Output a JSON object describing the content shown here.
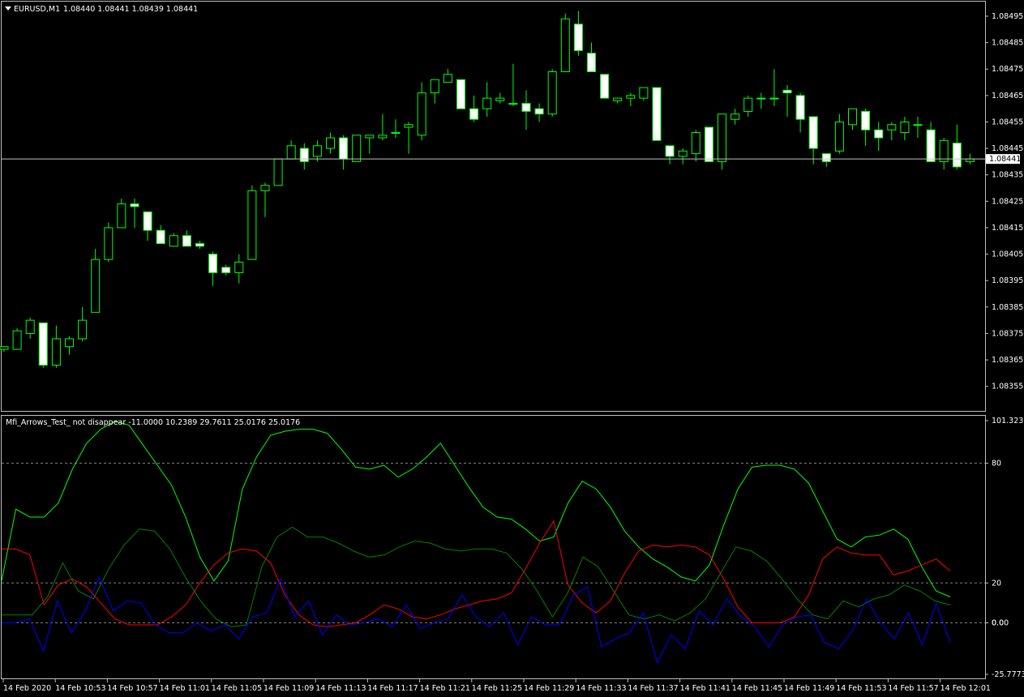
{
  "chart_data": [
    {
      "type": "candlestick",
      "title": "EURUSD,M1",
      "ohlc_header": "1.08440 1.08441 1.08439 1.08441",
      "current_price_label": "1.08441",
      "current_price": 1.08441,
      "ylim": [
        1.0835,
        1.08495
      ],
      "y_ticks": [
        "1.08495",
        "1.08485",
        "1.08475",
        "1.08465",
        "1.08455",
        "1.08445",
        "1.08435",
        "1.08425",
        "1.08415",
        "1.08405",
        "1.08395",
        "1.08385",
        "1.08375",
        "1.08365",
        "1.08355"
      ],
      "colors": {
        "up_outline": "#00ff00",
        "down_body": "#ffffff",
        "wick": "#00ff00",
        "price_line": "#c0c0c0"
      },
      "candles": [
        {
          "o": 1.08369,
          "h": 1.0837,
          "l": 1.08368,
          "c": 1.0837
        },
        {
          "o": 1.08369,
          "h": 1.08377,
          "l": 1.08369,
          "c": 1.08376
        },
        {
          "o": 1.08375,
          "h": 1.08381,
          "l": 1.08373,
          "c": 1.0838
        },
        {
          "o": 1.08379,
          "h": 1.08379,
          "l": 1.08362,
          "c": 1.08363
        },
        {
          "o": 1.08363,
          "h": 1.08378,
          "l": 1.08362,
          "c": 1.08373
        },
        {
          "o": 1.0837,
          "h": 1.08374,
          "l": 1.08367,
          "c": 1.08373
        },
        {
          "o": 1.08373,
          "h": 1.08385,
          "l": 1.08372,
          "c": 1.0838
        },
        {
          "o": 1.08383,
          "h": 1.08407,
          "l": 1.08383,
          "c": 1.08403
        },
        {
          "o": 1.08403,
          "h": 1.08417,
          "l": 1.08402,
          "c": 1.08415
        },
        {
          "o": 1.08415,
          "h": 1.08426,
          "l": 1.08415,
          "c": 1.08424
        },
        {
          "o": 1.08424,
          "h": 1.08426,
          "l": 1.08415,
          "c": 1.08423
        },
        {
          "o": 1.08421,
          "h": 1.08421,
          "l": 1.0841,
          "c": 1.08414
        },
        {
          "o": 1.08414,
          "h": 1.08416,
          "l": 1.08409,
          "c": 1.08409
        },
        {
          "o": 1.08408,
          "h": 1.08413,
          "l": 1.08408,
          "c": 1.08412
        },
        {
          "o": 1.08412,
          "h": 1.08414,
          "l": 1.08408,
          "c": 1.08408
        },
        {
          "o": 1.08409,
          "h": 1.0841,
          "l": 1.08407,
          "c": 1.08408
        },
        {
          "o": 1.08405,
          "h": 1.08406,
          "l": 1.08393,
          "c": 1.08398
        },
        {
          "o": 1.084,
          "h": 1.08401,
          "l": 1.08397,
          "c": 1.08398
        },
        {
          "o": 1.08398,
          "h": 1.08405,
          "l": 1.08394,
          "c": 1.08402
        },
        {
          "o": 1.08403,
          "h": 1.08431,
          "l": 1.08403,
          "c": 1.08429
        },
        {
          "o": 1.08429,
          "h": 1.08432,
          "l": 1.08419,
          "c": 1.08431
        },
        {
          "o": 1.08431,
          "h": 1.08441,
          "l": 1.08431,
          "c": 1.08441
        },
        {
          "o": 1.08441,
          "h": 1.08448,
          "l": 1.08441,
          "c": 1.08446
        },
        {
          "o": 1.08445,
          "h": 1.08447,
          "l": 1.08437,
          "c": 1.0844
        },
        {
          "o": 1.08442,
          "h": 1.08448,
          "l": 1.0844,
          "c": 1.08446
        },
        {
          "o": 1.08445,
          "h": 1.08451,
          "l": 1.08443,
          "c": 1.08449
        },
        {
          "o": 1.08449,
          "h": 1.0845,
          "l": 1.08437,
          "c": 1.08441
        },
        {
          "o": 1.0844,
          "h": 1.0845,
          "l": 1.0844,
          "c": 1.0845
        },
        {
          "o": 1.08449,
          "h": 1.0845,
          "l": 1.08443,
          "c": 1.0845
        },
        {
          "o": 1.08449,
          "h": 1.08458,
          "l": 1.08448,
          "c": 1.0845
        },
        {
          "o": 1.08451,
          "h": 1.08456,
          "l": 1.08449,
          "c": 1.08451
        },
        {
          "o": 1.08453,
          "h": 1.08455,
          "l": 1.08443,
          "c": 1.08454
        },
        {
          "o": 1.0845,
          "h": 1.0847,
          "l": 1.08448,
          "c": 1.08466
        },
        {
          "o": 1.08466,
          "h": 1.0847,
          "l": 1.08462,
          "c": 1.08471
        },
        {
          "o": 1.0847,
          "h": 1.08475,
          "l": 1.0847,
          "c": 1.08473
        },
        {
          "o": 1.08471,
          "h": 1.08471,
          "l": 1.0846,
          "c": 1.0846
        },
        {
          "o": 1.0846,
          "h": 1.08465,
          "l": 1.08455,
          "c": 1.08456
        },
        {
          "o": 1.0846,
          "h": 1.0847,
          "l": 1.08457,
          "c": 1.08464
        },
        {
          "o": 1.08463,
          "h": 1.08466,
          "l": 1.08462,
          "c": 1.08464
        },
        {
          "o": 1.08462,
          "h": 1.08477,
          "l": 1.08461,
          "c": 1.08462
        },
        {
          "o": 1.08462,
          "h": 1.08467,
          "l": 1.08452,
          "c": 1.08459
        },
        {
          "o": 1.0846,
          "h": 1.08462,
          "l": 1.08455,
          "c": 1.08458
        },
        {
          "o": 1.08458,
          "h": 1.08475,
          "l": 1.08457,
          "c": 1.08474
        },
        {
          "o": 1.08474,
          "h": 1.08496,
          "l": 1.08474,
          "c": 1.08494
        },
        {
          "o": 1.08492,
          "h": 1.08497,
          "l": 1.0848,
          "c": 1.08482
        },
        {
          "o": 1.08481,
          "h": 1.08485,
          "l": 1.08475,
          "c": 1.08474
        },
        {
          "o": 1.08473,
          "h": 1.08473,
          "l": 1.08464,
          "c": 1.08464
        },
        {
          "o": 1.08463,
          "h": 1.08464,
          "l": 1.08462,
          "c": 1.08464
        },
        {
          "o": 1.08464,
          "h": 1.08466,
          "l": 1.08461,
          "c": 1.08465
        },
        {
          "o": 1.08464,
          "h": 1.08468,
          "l": 1.08463,
          "c": 1.08468
        },
        {
          "o": 1.08468,
          "h": 1.08468,
          "l": 1.08448,
          "c": 1.08448
        },
        {
          "o": 1.08446,
          "h": 1.08446,
          "l": 1.08439,
          "c": 1.08442
        },
        {
          "o": 1.08442,
          "h": 1.08445,
          "l": 1.08439,
          "c": 1.08444
        },
        {
          "o": 1.08443,
          "h": 1.08452,
          "l": 1.0844,
          "c": 1.08451
        },
        {
          "o": 1.08453,
          "h": 1.08453,
          "l": 1.0844,
          "c": 1.0844
        },
        {
          "o": 1.0844,
          "h": 1.08458,
          "l": 1.08437,
          "c": 1.08458
        },
        {
          "o": 1.08456,
          "h": 1.0846,
          "l": 1.08454,
          "c": 1.08458
        },
        {
          "o": 1.08459,
          "h": 1.08465,
          "l": 1.08457,
          "c": 1.08464
        },
        {
          "o": 1.08464,
          "h": 1.08466,
          "l": 1.0846,
          "c": 1.08464
        },
        {
          "o": 1.08464,
          "h": 1.08475,
          "l": 1.08461,
          "c": 1.08464
        },
        {
          "o": 1.08467,
          "h": 1.08469,
          "l": 1.08457,
          "c": 1.08466
        },
        {
          "o": 1.08465,
          "h": 1.08466,
          "l": 1.08451,
          "c": 1.08456
        },
        {
          "o": 1.08457,
          "h": 1.08456,
          "l": 1.08439,
          "c": 1.08445
        },
        {
          "o": 1.08443,
          "h": 1.08443,
          "l": 1.08438,
          "c": 1.0844
        },
        {
          "o": 1.08444,
          "h": 1.08458,
          "l": 1.08443,
          "c": 1.08455
        },
        {
          "o": 1.08454,
          "h": 1.0846,
          "l": 1.08452,
          "c": 1.0846
        },
        {
          "o": 1.08459,
          "h": 1.0846,
          "l": 1.08446,
          "c": 1.08452
        },
        {
          "o": 1.08452,
          "h": 1.08455,
          "l": 1.08444,
          "c": 1.08449
        },
        {
          "o": 1.08452,
          "h": 1.08455,
          "l": 1.08448,
          "c": 1.08454
        },
        {
          "o": 1.08451,
          "h": 1.08457,
          "l": 1.08448,
          "c": 1.08455
        },
        {
          "o": 1.08454,
          "h": 1.08457,
          "l": 1.08449,
          "c": 1.08454
        },
        {
          "o": 1.08452,
          "h": 1.08455,
          "l": 1.08443,
          "c": 1.0844
        },
        {
          "o": 1.0844,
          "h": 1.08449,
          "l": 1.08437,
          "c": 1.08448
        },
        {
          "o": 1.08447,
          "h": 1.08454,
          "l": 1.08437,
          "c": 1.08438
        },
        {
          "o": 1.0844,
          "h": 1.08443,
          "l": 1.08439,
          "c": 1.08441
        }
      ]
    },
    {
      "type": "line",
      "title": "Mfi_Arrows_Test_ not disappear -11.0000 10.2389 29.7611 25.0176 25.0176",
      "ylim": [
        -25.7773,
        101.3236
      ],
      "y_ticks": [
        "101.3236",
        "80",
        "20",
        "0.0",
        "0.00",
        "-25.7773"
      ],
      "levels": [
        80,
        20,
        0
      ],
      "series": [
        {
          "color": "#00ff00",
          "values": [
            21,
            57,
            53,
            53,
            60,
            77,
            90,
            97,
            101,
            99,
            89,
            79,
            69,
            53,
            33,
            21,
            31,
            67,
            83,
            94,
            96,
            97,
            97,
            95,
            87,
            78,
            77,
            79,
            73,
            77,
            83,
            90,
            79,
            68,
            58,
            53,
            52,
            47,
            41,
            43,
            60,
            71,
            67,
            58,
            46,
            38,
            32,
            28,
            23,
            21,
            29,
            49,
            67,
            78,
            79,
            79,
            77,
            70,
            56,
            42,
            38,
            43,
            44,
            47,
            42,
            28,
            16,
            13
          ]
        },
        {
          "color": "#ff0000",
          "values": [
            37,
            37,
            34,
            9,
            19,
            22,
            18,
            10,
            2,
            -1,
            -1,
            -1,
            3,
            9,
            20,
            29,
            35,
            37,
            36,
            30,
            14,
            4,
            -1,
            -2,
            -1,
            0,
            4,
            9,
            7,
            3,
            2,
            4,
            7,
            9,
            11,
            12,
            15,
            27,
            40,
            51,
            19,
            10,
            5,
            11,
            25,
            36,
            39,
            38,
            39,
            38,
            34,
            22,
            8,
            0,
            0,
            0,
            3,
            14,
            32,
            38,
            35,
            34,
            34,
            24,
            26,
            29,
            32,
            26
          ]
        },
        {
          "color": "#008000",
          "values": [
            4,
            4,
            4,
            13,
            30,
            16,
            12,
            27,
            39,
            47,
            46,
            37,
            23,
            11,
            2,
            -2,
            -1,
            28,
            43,
            48,
            43,
            43,
            40,
            36,
            33,
            34,
            38,
            41,
            40,
            37,
            36,
            37,
            37,
            35,
            27,
            16,
            3,
            15,
            33,
            28,
            16,
            4,
            2,
            4,
            1,
            5,
            12,
            25,
            38,
            36,
            31,
            22,
            12,
            4,
            2,
            11,
            8,
            12,
            14,
            19,
            16,
            11,
            9
          ]
        },
        {
          "color": "#0000ff",
          "values": [
            0,
            0,
            2,
            -14,
            11,
            -5,
            6,
            23,
            6,
            11,
            10,
            -1,
            -5,
            -5,
            0,
            -4,
            -1,
            -8,
            3,
            5,
            22,
            3,
            11,
            -6,
            4,
            -1,
            0,
            2,
            -2,
            9,
            -3,
            0,
            2,
            14,
            3,
            -2,
            5,
            -11,
            3,
            -1,
            -1,
            14,
            18,
            -12,
            -8,
            -5,
            5,
            -20,
            -6,
            -13,
            6,
            -1,
            12,
            3,
            -2,
            -12,
            -1,
            3,
            4,
            -10,
            -13,
            -4,
            12,
            0,
            -8,
            5,
            -11,
            10,
            -10
          ]
        }
      ]
    }
  ],
  "x_ticks": [
    "14 Feb 2020",
    "14 Feb 10:53",
    "14 Feb 10:57",
    "14 Feb 11:01",
    "14 Feb 11:05",
    "14 Feb 11:09",
    "14 Feb 11:13",
    "14 Feb 11:17",
    "14 Feb 11:21",
    "14 Feb 11:25",
    "14 Feb 11:29",
    "14 Feb 11:33",
    "14 Feb 11:37",
    "14 Feb 11:41",
    "14 Feb 11:45",
    "14 Feb 11:49",
    "14 Feb 11:53",
    "14 Feb 11:57",
    "14 Feb 12:01"
  ]
}
